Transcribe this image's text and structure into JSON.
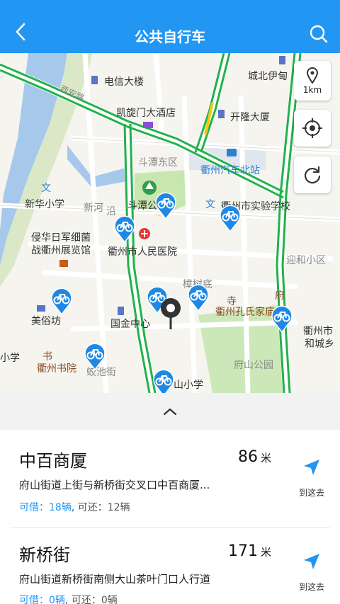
{
  "header": {
    "title": "公共自行车"
  },
  "map": {
    "scale_label": "1km",
    "labels": {
      "telecom": "电信大楼",
      "chengbei": "城北伊甸",
      "xianjie": "西安路",
      "kaixuanmen": "凯旋门大酒店",
      "kailong": "开隆大厦",
      "doutan": "斗潭东区",
      "bus_station": "衢州汽车北站",
      "xinsha": "新华小学",
      "xinhe": "新河",
      "yan": "沿",
      "doutan_park": "斗潭公园",
      "shiyan": "衢州市实验学校",
      "qinhua1": "侵华日军细菌",
      "qinhua2": "战衢州展览馆",
      "hospital": "衢州市人民医院",
      "yinghe": "迎和小区",
      "zhangshu": "樟树底",
      "fu": "府",
      "kongshi": "衢州孔氏家庙",
      "meisu": "美俗坊",
      "guojin": "国金中心",
      "quzhoushi": "衢州市",
      "hechengxiang": "和城乡",
      "school_x": "小学",
      "shuyuan": "衢州书院",
      "jiaochi": "蛟池街",
      "fushan_park": "府山公园",
      "shan_school": "山小学"
    }
  },
  "stations": [
    {
      "name": "中百商厦",
      "distance": "86",
      "unit": "米",
      "address": "府山街道上街与新桥街交叉口中百商厦...",
      "borrow_label": "可借：",
      "borrow_count": "18辆",
      "return_label": ", 可还：",
      "return_count": "12辆",
      "go_label": "到这去"
    },
    {
      "name": "新桥街",
      "distance": "171",
      "unit": "米",
      "address": "府山街道新桥街南侧大山茶叶门口人行道",
      "borrow_label": "可借：",
      "borrow_count": "0辆",
      "return_label": ", 可还：",
      "return_count": "0辆",
      "go_label": "到这去"
    }
  ],
  "colors": {
    "primary": "#2196f3",
    "road_green": "#22b14c",
    "river": "#a6c8ea",
    "park": "#cde8b8"
  }
}
